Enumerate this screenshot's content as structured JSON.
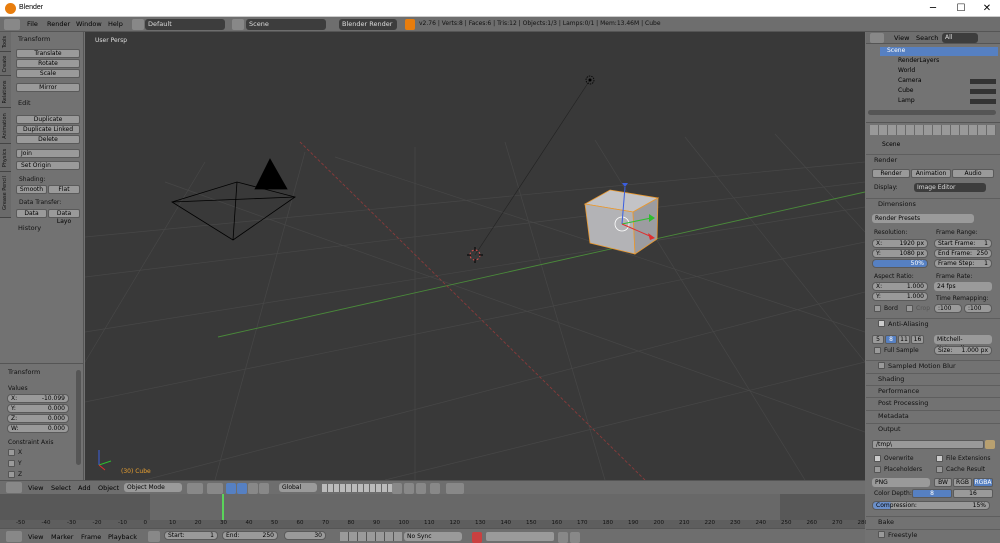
{
  "window": {
    "title": "Blender",
    "controls": [
      "─",
      "☐",
      "✕"
    ]
  },
  "topbar": {
    "menus": [
      "File",
      "Render",
      "Window",
      "Help"
    ],
    "layout": "Default",
    "scene": "Scene",
    "engine": "Blender Render",
    "stats": "v2.76 | Verts:8 | Faces:6 | Tris:12 | Objects:1/3 | Lamps:0/1 | Mem:13.46M | Cube"
  },
  "toolshelf": {
    "tabs": [
      "Tools",
      "Create",
      "Relations",
      "Animation",
      "Physics",
      "Grease Pencil"
    ],
    "transform_header": "Transform",
    "transform_buttons": [
      "Translate",
      "Rotate",
      "Scale"
    ],
    "mirror": "Mirror",
    "edit_header": "Edit",
    "edit_buttons": [
      "Duplicate",
      "Duplicate Linked",
      "Delete"
    ],
    "join": "Join",
    "set_origin": "Set Origin",
    "shading_label": "Shading:",
    "smooth": "Smooth",
    "flat": "Flat",
    "data_transfer_label": "Data Transfer:",
    "data": "Data",
    "data_layout": "Data Layo",
    "history": "History"
  },
  "operator": {
    "header": "Transform",
    "values_label": "Values",
    "fields": [
      {
        "k": "X:",
        "v": "-10.099"
      },
      {
        "k": "Y:",
        "v": "0.000"
      },
      {
        "k": "Z:",
        "v": "0.000"
      },
      {
        "k": "W:",
        "v": "0.000"
      }
    ],
    "constraint_label": "Constraint Axis",
    "axes": [
      "X",
      "Y",
      "Z"
    ]
  },
  "viewport": {
    "label": "User Persp",
    "object_label": "(30) Cube"
  },
  "viewport_header": {
    "menus": [
      "View",
      "Select",
      "Add",
      "Object"
    ],
    "mode": "Object Mode",
    "orientation": "Global"
  },
  "timeline": {
    "ticks": [
      "-50",
      "-40",
      "-30",
      "-20",
      "-10",
      "0",
      "10",
      "20",
      "30",
      "40",
      "50",
      "60",
      "70",
      "80",
      "90",
      "100",
      "110",
      "120",
      "130",
      "140",
      "150",
      "160",
      "170",
      "180",
      "190",
      "200",
      "210",
      "220",
      "230",
      "240",
      "250",
      "260",
      "270",
      "280"
    ],
    "current": 30
  },
  "timeline_header": {
    "menus": [
      "View",
      "Marker",
      "Frame",
      "Playback"
    ],
    "start": "Start:",
    "start_val": "1",
    "end": "End:",
    "end_val": "250",
    "current": "30",
    "sync": "No Sync"
  },
  "outliner": {
    "menus": [
      "View",
      "Search"
    ],
    "filter": "All Scenes",
    "items": [
      "Scene",
      "RenderLayers",
      "World",
      "Camera",
      "Cube",
      "Lamp"
    ]
  },
  "properties": {
    "context": "Scene",
    "render_header": "Render",
    "render_buttons": [
      "Render",
      "Animation",
      "Audio"
    ],
    "display_label": "Display:",
    "display_value": "Image Editor",
    "dimensions_header": "Dimensions",
    "presets": "Render Presets",
    "resolution_label": "Resolution:",
    "res_x": {
      "k": "X:",
      "v": "1920 px"
    },
    "res_y": {
      "k": "Y:",
      "v": "1080 px"
    },
    "res_pct": "50%",
    "frame_range_label": "Frame Range:",
    "start_frame": {
      "k": "Start Frame:",
      "v": "1"
    },
    "end_frame": {
      "k": "End Frame:",
      "v": "250"
    },
    "frame_step": {
      "k": "Frame Step:",
      "v": "1"
    },
    "aspect_label": "Aspect Ratio:",
    "asp_x": {
      "k": "X:",
      "v": "1.000"
    },
    "asp_y": {
      "k": "Y:",
      "v": "1.000"
    },
    "frame_rate_label": "Frame Rate:",
    "fps": "24 fps",
    "time_remap_label": "Time Remapping:",
    "remap_old": ":100",
    "remap_new": ":100",
    "bord": "Bord",
    "crop": "Crop",
    "aa_header": "Anti-Aliasing",
    "aa_samples": [
      "5",
      "8",
      "11",
      "16"
    ],
    "aa_filter": "Mitchell-Netravali",
    "full_sample": "Full Sample",
    "size": {
      "k": "Size:",
      "v": "1.000 px"
    },
    "collapsed": [
      "Sampled Motion Blur",
      "Shading",
      "Performance",
      "Post Processing",
      "Metadata"
    ],
    "output_header": "Output",
    "output_path": "/tmp\\",
    "overwrite": "Overwrite",
    "file_ext": "File Extensions",
    "placeholders": "Placeholders",
    "cache": "Cache Result",
    "format": "PNG",
    "bw": "BW",
    "rgb": "RGB",
    "rgba": "RGBA",
    "color_depth_label": "Color Depth:",
    "depth8": "8",
    "depth16": "16",
    "compression": {
      "k": "Compression:",
      "v": "15%"
    },
    "bake": "Bake",
    "freestyle": "Freestyle"
  }
}
